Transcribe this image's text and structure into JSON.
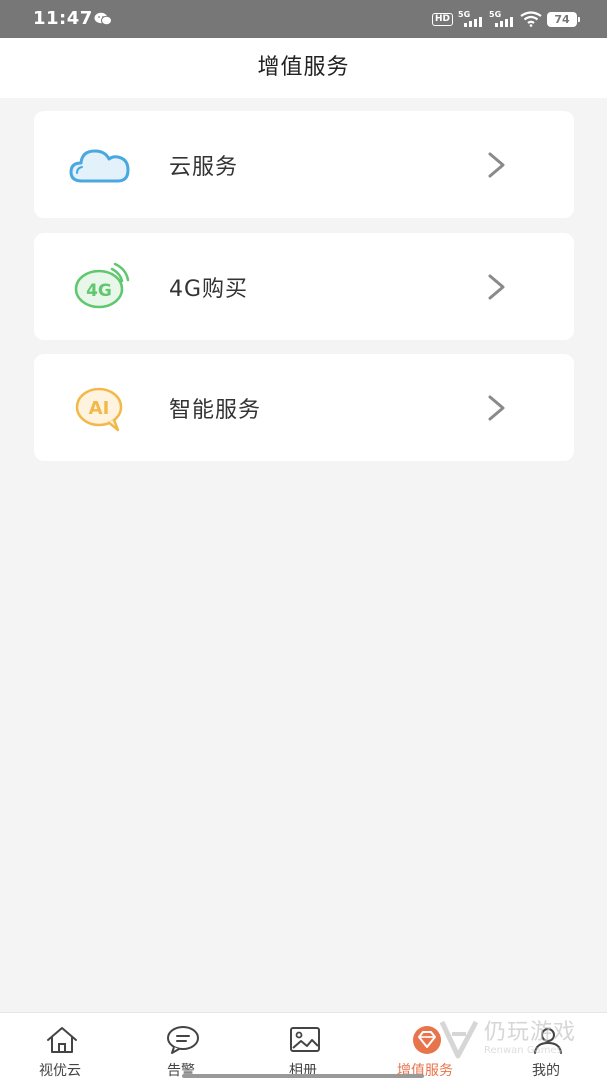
{
  "status_bar": {
    "time": "11:47",
    "hd_label": "HD",
    "signal1_label": "5G",
    "signal2_label": "5G",
    "battery": "74"
  },
  "header": {
    "title": "增值服务"
  },
  "services": [
    {
      "label": "云服务",
      "icon": "cloud-icon"
    },
    {
      "label": "4G购买",
      "icon": "4g-icon",
      "icon_text": "4G"
    },
    {
      "label": "智能服务",
      "icon": "ai-icon",
      "icon_text": "AI"
    }
  ],
  "tabs": [
    {
      "label": "视优云",
      "icon": "home-icon",
      "active": false
    },
    {
      "label": "告警",
      "icon": "alarm-icon",
      "active": false
    },
    {
      "label": "相册",
      "icon": "album-icon",
      "active": false
    },
    {
      "label": "增值服务",
      "icon": "diamond-icon",
      "active": true
    },
    {
      "label": "我的",
      "icon": "user-icon",
      "active": false
    }
  ],
  "watermark": {
    "text": "仍玩游戏",
    "sub": "Renwan Games"
  },
  "colors": {
    "accent": "#e8744b",
    "cloud": "#4aa8e0",
    "four_g": "#5fc76e",
    "ai": "#f2b94a",
    "background": "#f4f4f4"
  }
}
